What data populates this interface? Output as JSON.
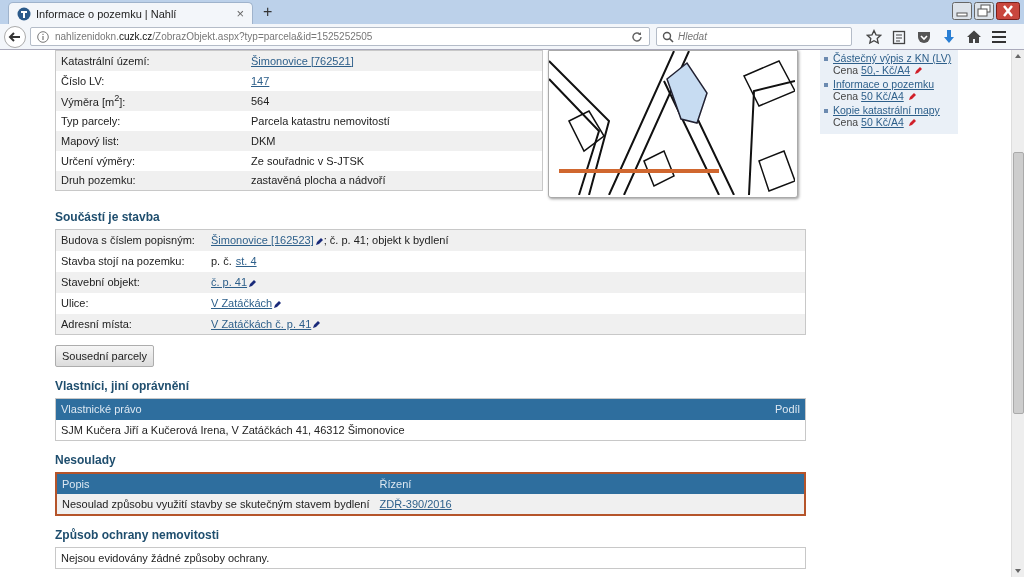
{
  "browser": {
    "tab": {
      "title": "Informace o pozemku | Nahlí",
      "close": "×"
    },
    "new_tab": "+",
    "url": "nahlizenidokn.**cuzk.cz**/ZobrazObjekt.aspx?typ=parcela&id=1525252505",
    "search": {
      "placeholder": "Hledat"
    }
  },
  "parcel_table": [
    {
      "label": "Katastrální území:",
      "value": "Šimonovice [762521]",
      "link": true
    },
    {
      "label": "Číslo LV:",
      "value": "147",
      "link": true
    },
    {
      "label": "Výměra [m$^{2}$]:",
      "value": "564",
      "link": false
    },
    {
      "label": "Typ parcely:",
      "value": "Parcela katastru nemovitostí",
      "link": false
    },
    {
      "label": "Mapový list:",
      "value": "DKM",
      "link": false
    },
    {
      "label": "Určení výměry:",
      "value": "Ze souřadnic v S-JTSK",
      "link": false
    },
    {
      "label": "Druh pozemku:",
      "value": "zastavěná plocha a nádvoří",
      "link": false
    }
  ],
  "products": [
    {
      "title": "Částečný výpis z KN (LV)",
      "price_label": "Cena",
      "price": "50,- Kč/A4"
    },
    {
      "title": "Informace o pozemku",
      "price_label": "Cena",
      "price": "50 Kč/A4"
    },
    {
      "title": "Kopie katastrální mapy",
      "price_label": "Cena",
      "price": "50 Kč/A4"
    }
  ],
  "building": {
    "heading": "Součástí je stavba",
    "rows": [
      {
        "label": "Budova s číslem popisným:",
        "parts": [
          {
            "kind": "link",
            "text": "Šimonovice [162523]",
            "edit": true
          },
          {
            "kind": "text",
            "text": "; č. p. 41; objekt k bydlení"
          }
        ]
      },
      {
        "label": "Stavba stojí na pozemku:",
        "parts": [
          {
            "kind": "text",
            "text": "p. č."
          },
          {
            "kind": "link",
            "text": "st. 4",
            "edit": false
          }
        ]
      },
      {
        "label": "Stavební objekt:",
        "parts": [
          {
            "kind": "link",
            "text": "č. p. 41",
            "edit": true
          }
        ]
      },
      {
        "label": "Ulice:",
        "parts": [
          {
            "kind": "link",
            "text": "V Zatáčkách",
            "edit": true
          }
        ]
      },
      {
        "label": "Adresní místa:",
        "parts": [
          {
            "kind": "link",
            "text": "V Zatáčkách č. p. 41",
            "edit": true
          }
        ]
      }
    ]
  },
  "neighbours_button": "Sousední parcely",
  "owners": {
    "heading": "Vlastníci, jiní oprávnění",
    "columns": [
      "Vlastnické právo",
      "Podíl"
    ],
    "rows": [
      [
        "SJM Kučera Jiří a Kučerová Irena, V Zatáčkách 41, 46312 Šimonovice"
      ]
    ]
  },
  "discrepancies": {
    "heading": "Nesoulady",
    "columns": [
      "Popis",
      "Řízení"
    ],
    "rows": [
      {
        "description": "Nesoulad způsobu využití stavby se skutečným stavem bydlení",
        "proceeding": "ZDŘ-390/2016"
      }
    ]
  },
  "protection": {
    "heading": "Způsob ochrany nemovitosti",
    "text": "Nejsou evidovány žádné způsoby ochrany."
  }
}
